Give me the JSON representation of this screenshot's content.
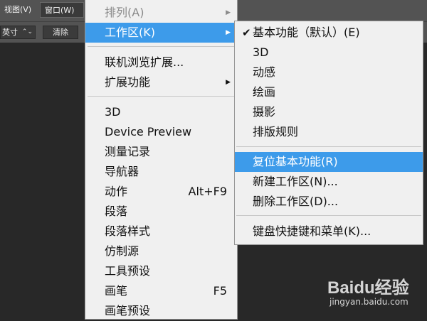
{
  "menubar": {
    "items": [
      {
        "label": "视图(V)"
      },
      {
        "label": "窗口(W)"
      }
    ]
  },
  "options": {
    "unit_value": "英寸",
    "clear_label": "清除"
  },
  "window_menu": {
    "items": [
      {
        "label": "排列(A)"
      },
      {
        "label": "工作区(K)"
      },
      {
        "label": "联机浏览扩展..."
      },
      {
        "label": "扩展功能"
      },
      {
        "label": "3D"
      },
      {
        "label": "Device Preview"
      },
      {
        "label": "测量记录"
      },
      {
        "label": "导航器"
      },
      {
        "label": "动作",
        "shortcut": "Alt+F9"
      },
      {
        "label": "段落"
      },
      {
        "label": "段落样式"
      },
      {
        "label": "仿制源"
      },
      {
        "label": "工具预设"
      },
      {
        "label": "画笔",
        "shortcut": "F5"
      },
      {
        "label": "画笔预设"
      }
    ]
  },
  "workspace_menu": {
    "items": [
      {
        "label": "基本功能（默认）(E)",
        "checked": true
      },
      {
        "label": "3D"
      },
      {
        "label": "动感"
      },
      {
        "label": "绘画"
      },
      {
        "label": "摄影"
      },
      {
        "label": "排版规则"
      },
      {
        "label": "复位基本功能(R)"
      },
      {
        "label": "新建工作区(N)..."
      },
      {
        "label": "删除工作区(D)..."
      },
      {
        "label": "键盘快捷键和菜单(K)..."
      }
    ]
  },
  "glyphs": {
    "submenu_arrow": "▶",
    "check": "✔",
    "dropdown": "⌃⌄"
  },
  "watermark": {
    "logo_text": "Baidu经验",
    "url": "jingyan.baidu.com"
  },
  "colors": {
    "highlight": "#3d9bea",
    "menu_bg": "#f0f0f0",
    "app_bg": "#282828"
  }
}
